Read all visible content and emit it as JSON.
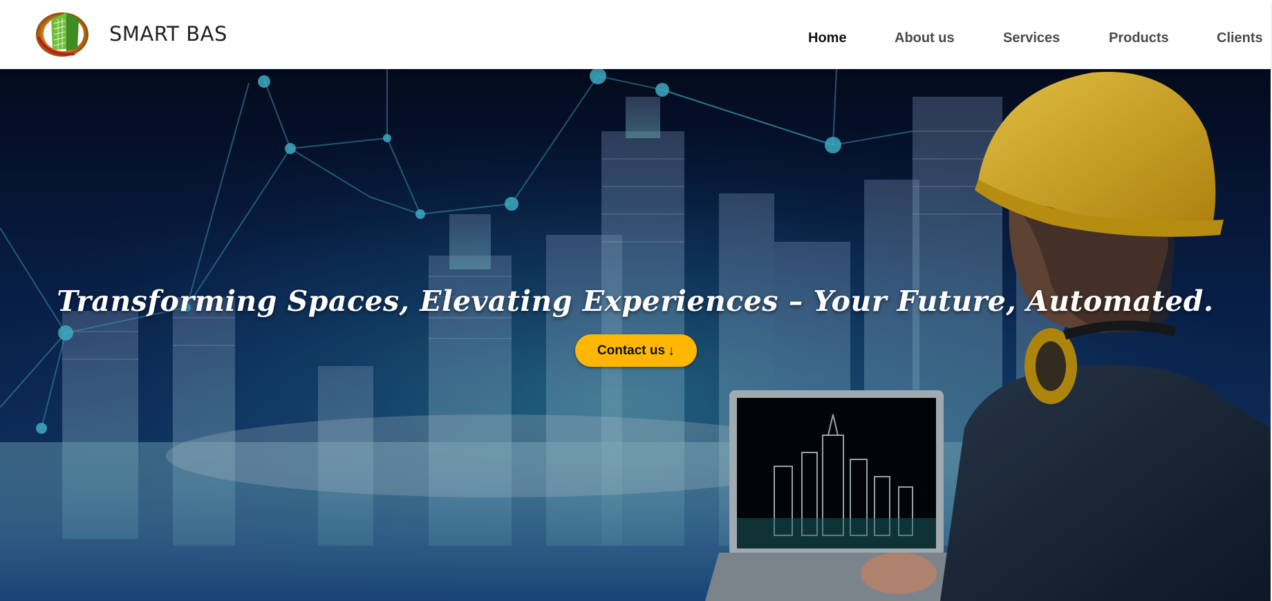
{
  "header": {
    "brand_name": "SMART BAS",
    "logo_icon": "building-globe-logo-icon"
  },
  "nav": {
    "items": [
      {
        "label": "Home",
        "active": true
      },
      {
        "label": "About us",
        "active": false
      },
      {
        "label": "Services",
        "active": false
      },
      {
        "label": "Products",
        "active": false
      },
      {
        "label": "Clients",
        "active": false
      }
    ]
  },
  "hero": {
    "tagline": "Transforming Spaces, Elevating Experiences – Your Future, Automated.",
    "cta_label": "Contact us",
    "cta_icon": "arrow-down-icon"
  },
  "colors": {
    "accent": "#ffb703",
    "hero_background": "#071434",
    "nav_text": "#4a4a4a",
    "nav_active": "#111111"
  }
}
